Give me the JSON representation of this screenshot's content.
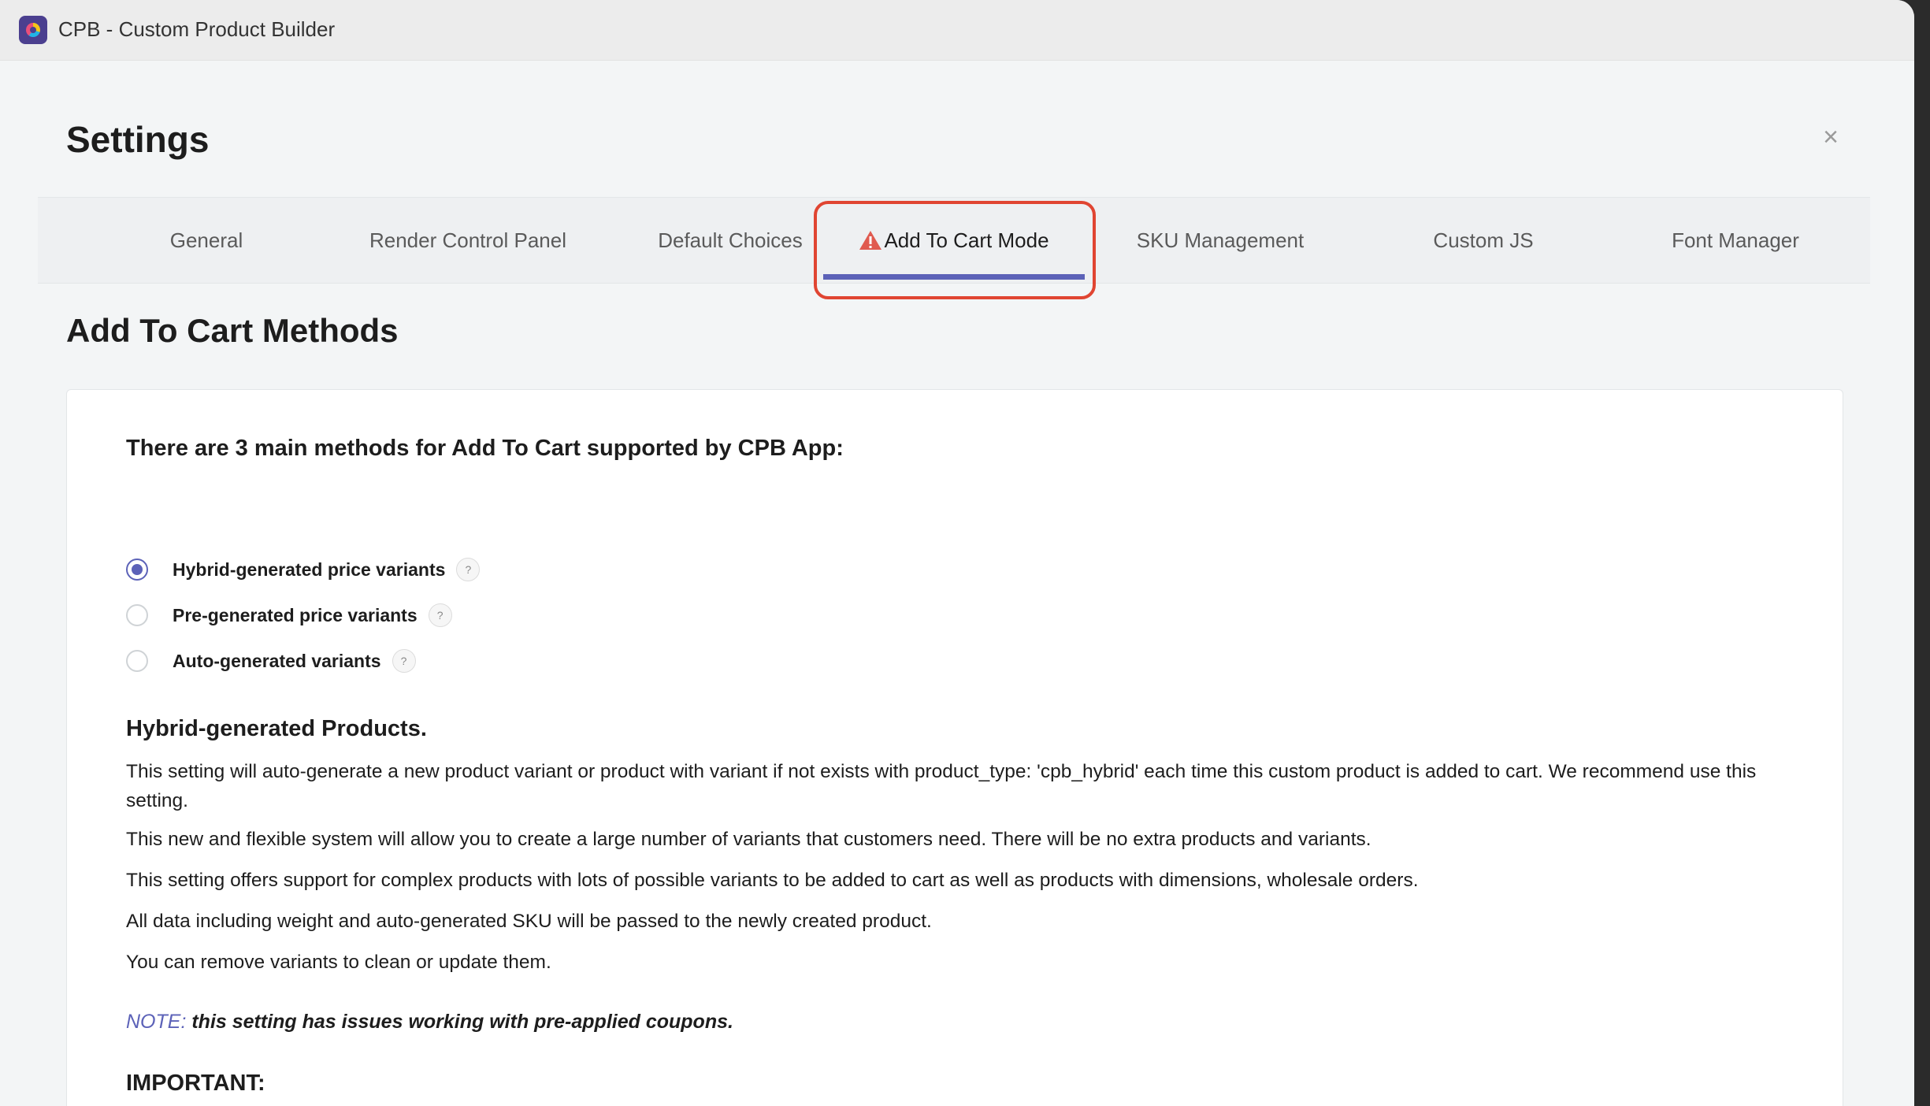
{
  "app": {
    "title": "CPB - Custom Product Builder"
  },
  "header": {
    "title": "Settings",
    "close_symbol": "×"
  },
  "tabs": [
    {
      "label": "General",
      "active": false
    },
    {
      "label": "Render Control Panel",
      "active": false
    },
    {
      "label": "Default Choices",
      "active": false
    },
    {
      "label": "Add To Cart Mode",
      "active": true,
      "icon": "warning-icon"
    },
    {
      "label": "SKU Management",
      "active": false
    },
    {
      "label": "Custom JS",
      "active": false
    },
    {
      "label": "Font Manager",
      "active": false
    }
  ],
  "main": {
    "heading": "Add To Cart Methods",
    "intro": "There are 3 main methods for Add To Cart supported by CPB App:",
    "options": [
      {
        "label": "Hybrid-generated price variants",
        "checked": true,
        "help": "?"
      },
      {
        "label": "Pre-generated price variants",
        "checked": false,
        "help": "?"
      },
      {
        "label": "Auto-generated variants",
        "checked": false,
        "help": "?"
      }
    ],
    "description": {
      "title": "Hybrid-generated Products.",
      "paragraphs": [
        "This setting will auto-generate a new product variant or product with variant if not exists with product_type: 'cpb_hybrid' each time this custom product is added to cart. We recommend use this setting.",
        "This new and flexible system will allow you to create a large number of variants that customers need. There will be no extra products and variants.",
        "This setting offers support for complex products with lots of possible variants to be added to cart as well as products with dimensions, wholesale orders.",
        "All data including weight and auto-generated SKU will be passed to the newly created product.",
        "You can remove variants to clean or update them."
      ],
      "note_label": "NOTE:",
      "note_text": " this setting has issues working with pre-applied coupons.",
      "important": "IMPORTANT:"
    }
  },
  "colors": {
    "accent": "#5c62b8",
    "highlight": "#e04532",
    "warning": "#e05a4f"
  }
}
